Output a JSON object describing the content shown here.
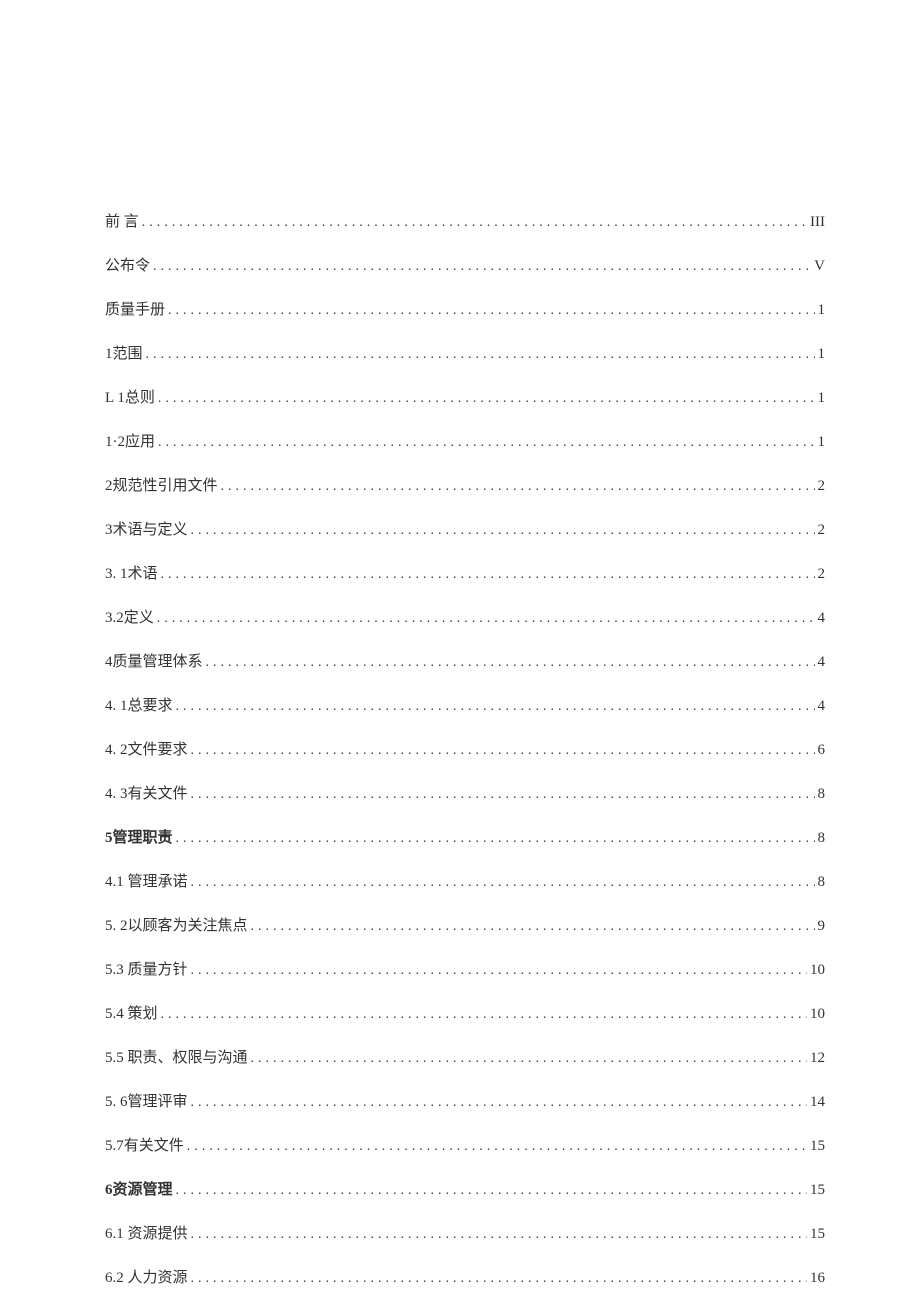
{
  "toc": [
    {
      "label": "前  言",
      "page": "III",
      "bold": false
    },
    {
      "label": "公布令",
      "page": "V",
      "bold": false
    },
    {
      "label": "质量手册",
      "page": "1",
      "bold": false
    },
    {
      "label": "1范围",
      "page": "1",
      "bold": false
    },
    {
      "label": "L 1总则",
      "page": "1",
      "bold": false
    },
    {
      "label": "1·2应用",
      "page": "1",
      "bold": false
    },
    {
      "label": "2规范性引用文件",
      "page": "2",
      "bold": false
    },
    {
      "label": "3术语与定义",
      "page": "2",
      "bold": false
    },
    {
      "label": "3.   1术语",
      "page": "2",
      "bold": false
    },
    {
      "label": "3.2定义",
      "page": "4",
      "bold": false
    },
    {
      "label": "4质量管理体系",
      "page": "4",
      "bold": false
    },
    {
      "label": "4.   1总要求",
      "page": "4",
      "bold": false
    },
    {
      "label": "4.   2文件要求",
      "page": "6",
      "bold": false
    },
    {
      "label": "4.   3有关文件",
      "page": "8",
      "bold": false
    },
    {
      "label": "5管理职责",
      "page": "8",
      "bold": true
    },
    {
      "label": "4.1    管理承诺",
      "page": "8",
      "bold": false
    },
    {
      "label": "5.   2以顾客为关注焦点",
      "page": "9",
      "bold": false
    },
    {
      "label": "5.3    质量方针",
      "page": "10",
      "bold": false
    },
    {
      "label": "5.4    策划",
      "page": "10",
      "bold": false
    },
    {
      "label": "5.5    职责、权限与沟通",
      "page": "12",
      "bold": false
    },
    {
      "label": "5. 6管理评审",
      "page": "14",
      "bold": false
    },
    {
      "label": "5.7有关文件",
      "page": "15",
      "bold": false
    },
    {
      "label": "6资源管理",
      "page": "15",
      "bold": true
    },
    {
      "label": "6.1    资源提供",
      "page": "15",
      "bold": false
    },
    {
      "label": "6.2    人力资源",
      "page": "16",
      "bold": false
    }
  ]
}
